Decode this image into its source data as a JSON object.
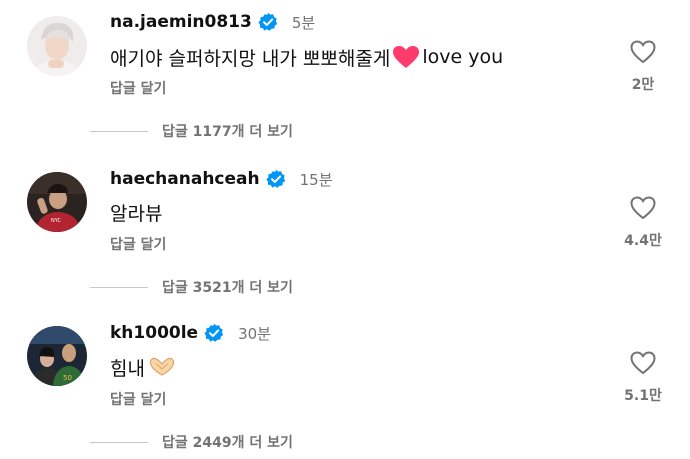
{
  "comments": [
    {
      "username": "na.jaemin0813",
      "timestamp": "5분",
      "text": "애기야 슬퍼하지망 내가 뽀뽀해줄게",
      "text_suffix": " love you",
      "reply_label": "답글 달기",
      "like_count": "2만",
      "view_replies": "답글 1177개 더 보기",
      "avatar_icon": "avatar-photo"
    },
    {
      "username": "haechanahceah",
      "timestamp": "15분",
      "text": "알라뷰",
      "reply_label": "답글 달기",
      "like_count": "4.4만",
      "view_replies": "답글 3521개 더 보기",
      "avatar_icon": "avatar-photo"
    },
    {
      "username": "kh1000le",
      "timestamp": "30분",
      "text": "힘내",
      "reply_label": "답글 달기",
      "like_count": "5.1만",
      "view_replies": "답글 2449개 더 보기",
      "avatar_icon": "avatar-photo"
    }
  ],
  "colors": {
    "verified": "#0095f6",
    "secondary_text": "#737373",
    "heart_emoji": "#ff3b6b"
  },
  "icons": {
    "verified": "verified-badge-icon",
    "like": "heart-outline-icon",
    "emoji_1": "red-heart-emoji",
    "emoji_3": "heart-hands-emoji"
  }
}
